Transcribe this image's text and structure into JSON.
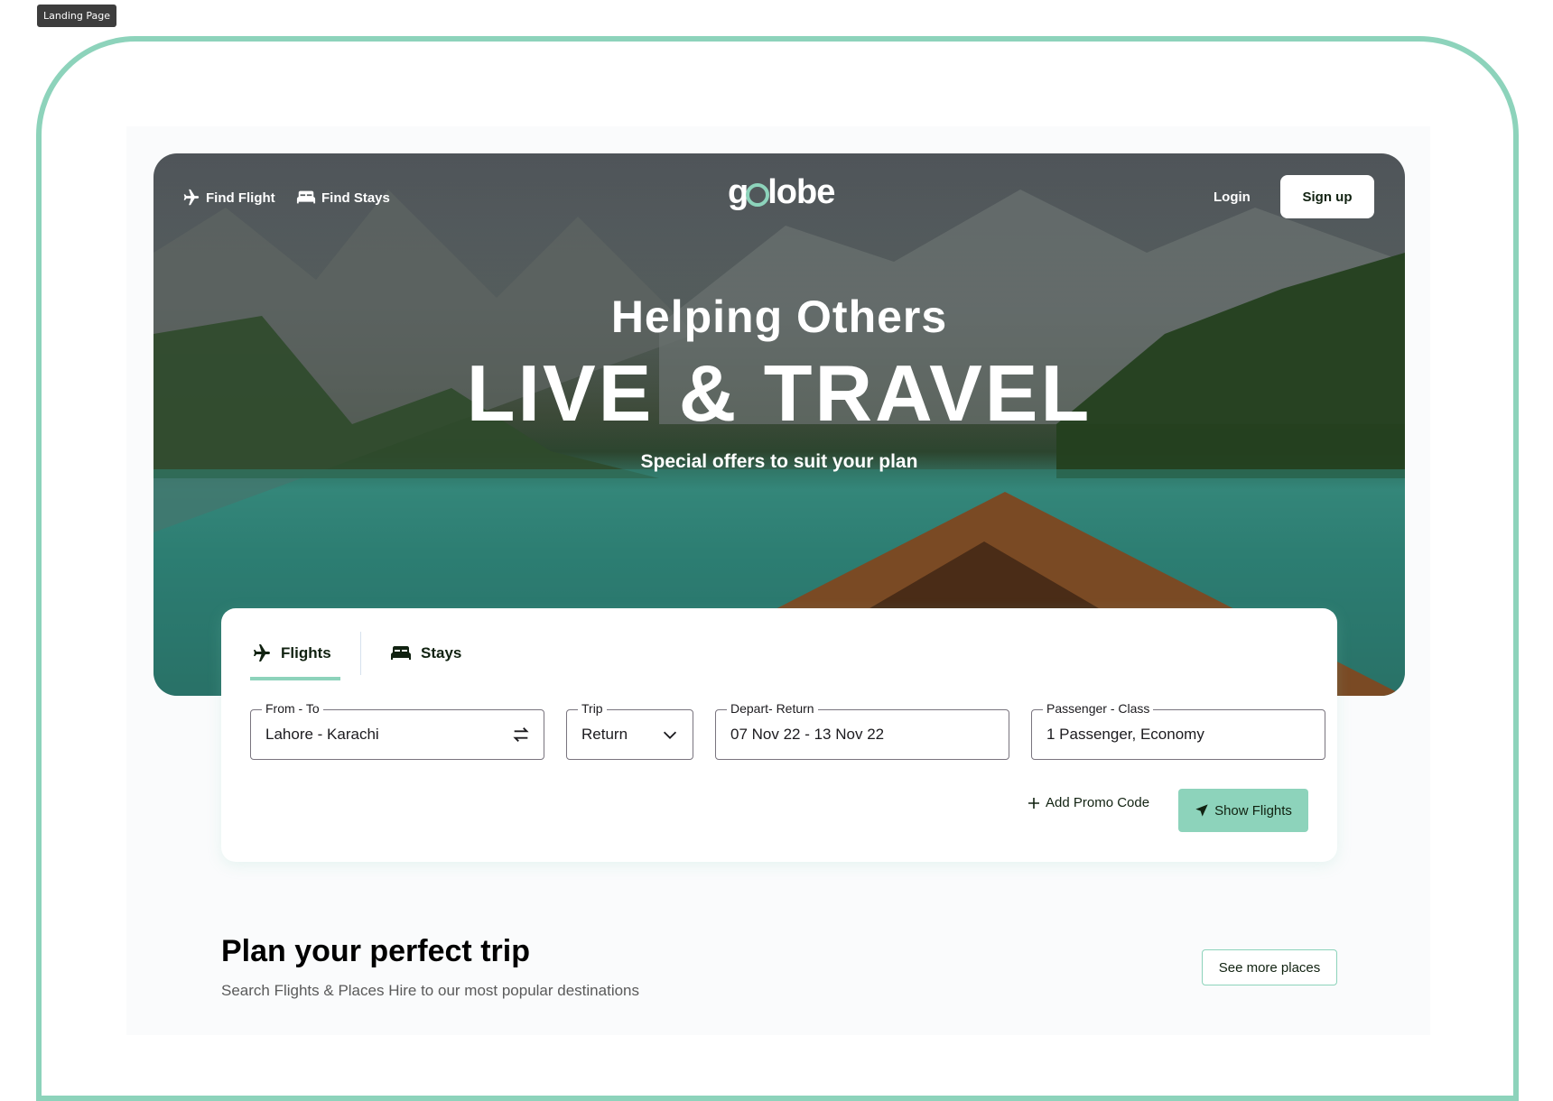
{
  "frame_label": "Landing Page",
  "nav": {
    "find_flight": "Find Flight",
    "find_stays": "Find Stays",
    "logo_left": "g",
    "logo_right": "lobe",
    "login": "Login",
    "signup": "Sign up"
  },
  "hero": {
    "line1": "Helping Others",
    "line2": "LIVE & TRAVEL",
    "line3": "Special offers to suit your plan"
  },
  "search": {
    "tabs": [
      {
        "label": "Flights",
        "icon": "airplane-icon",
        "active": true
      },
      {
        "label": "Stays",
        "icon": "bed-icon",
        "active": false
      }
    ],
    "fields": {
      "from_to": {
        "label": "From - To",
        "value": "Lahore - Karachi"
      },
      "trip": {
        "label": "Trip",
        "value": "Return"
      },
      "depart_return": {
        "label": "Depart- Return",
        "value": "07 Nov 22 - 13 Nov 22"
      },
      "passenger_class": {
        "label": "Passenger - Class",
        "value": "1 Passenger, Economy"
      }
    },
    "add_promo": "Add Promo Code",
    "show_flights": "Show Flights"
  },
  "plan_section": {
    "title": "Plan your perfect trip",
    "subtitle": "Search Flights & Places Hire to our most popular destinations",
    "see_more": "See more places"
  },
  "colors": {
    "accent": "#8DD3BB",
    "text_dark": "#112211"
  }
}
